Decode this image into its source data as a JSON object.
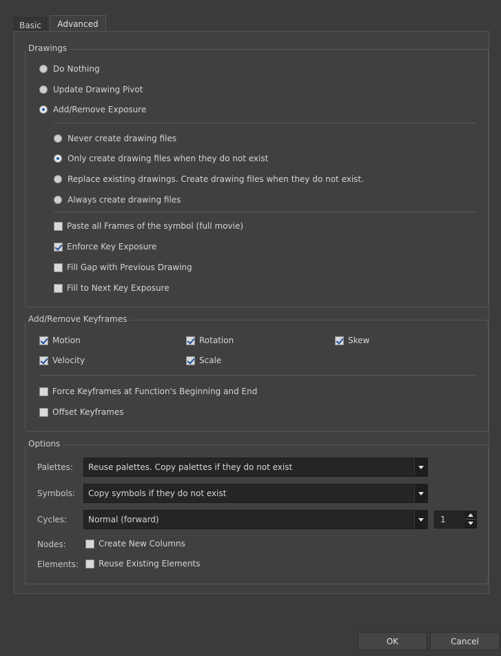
{
  "tabs": [
    {
      "label": "Basic"
    },
    {
      "label": "Advanced"
    }
  ],
  "drawings": {
    "title": "Drawings",
    "mode_options": [
      {
        "label": "Do Nothing",
        "selected": false
      },
      {
        "label": "Update Drawing Pivot",
        "selected": false
      },
      {
        "label": "Add/Remove Exposure",
        "selected": true
      }
    ],
    "file_options": [
      {
        "label": "Never create drawing files",
        "selected": false
      },
      {
        "label": "Only create drawing files when they do not exist",
        "selected": true
      },
      {
        "label": "Replace existing drawings. Create drawing files when they do not exist.",
        "selected": false
      },
      {
        "label": "Always create drawing files",
        "selected": false
      }
    ],
    "checks": [
      {
        "label": "Paste all Frames of the symbol (full movie)",
        "checked": false
      },
      {
        "label": "Enforce Key Exposure",
        "checked": true
      },
      {
        "label": "Fill Gap with Previous Drawing",
        "checked": false
      },
      {
        "label": "Fill to Next Key Exposure",
        "checked": false
      }
    ]
  },
  "keyframes": {
    "title": "Add/Remove Keyframes",
    "items": [
      {
        "label": "Motion",
        "checked": true
      },
      {
        "label": "Rotation",
        "checked": true
      },
      {
        "label": "Skew",
        "checked": true
      },
      {
        "label": "Velocity",
        "checked": true
      },
      {
        "label": "Scale",
        "checked": true
      }
    ],
    "force": {
      "label": "Force Keyframes at Function's Beginning and End",
      "checked": false
    },
    "offset": {
      "label": "Offset Keyframes",
      "checked": false
    }
  },
  "options": {
    "title": "Options",
    "palettes": {
      "label": "Palettes:",
      "value": "Reuse palettes. Copy palettes if they do not exist"
    },
    "symbols": {
      "label": "Symbols:",
      "value": "Copy symbols if they do not exist"
    },
    "cycles": {
      "label": "Cycles:",
      "value": "Normal (forward)",
      "count": "1"
    },
    "nodes": {
      "label": "Nodes:",
      "check_label": "Create New Columns",
      "checked": false
    },
    "elements": {
      "label": "Elements:",
      "check_label": "Reuse Existing Elements",
      "checked": false
    }
  },
  "buttons": {
    "ok": "OK",
    "cancel": "Cancel"
  }
}
